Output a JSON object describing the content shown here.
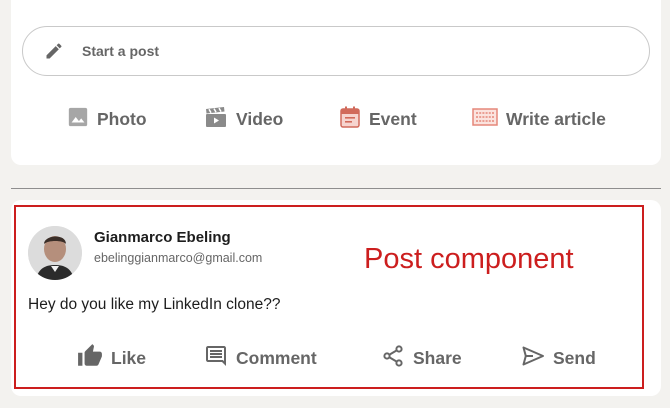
{
  "composer": {
    "placeholder": "Start a post",
    "actions": [
      {
        "label": "Photo",
        "icon": "photo-icon",
        "color": "#9e9e9e"
      },
      {
        "label": "Video",
        "icon": "video-icon",
        "color": "#8a8a8a"
      },
      {
        "label": "Event",
        "icon": "event-icon",
        "color": "#d16a5b"
      },
      {
        "label": "Write article",
        "icon": "article-icon",
        "color": "#e5877a"
      }
    ]
  },
  "post": {
    "author_name": "Gianmarco Ebeling",
    "author_email": "ebelinggianmarco@gmail.com",
    "text": "Hey do you like my LinkedIn clone??",
    "actions": [
      "Like",
      "Comment",
      "Share",
      "Send"
    ]
  },
  "annotation": {
    "label": "Post component",
    "color": "#cc1e1e"
  }
}
